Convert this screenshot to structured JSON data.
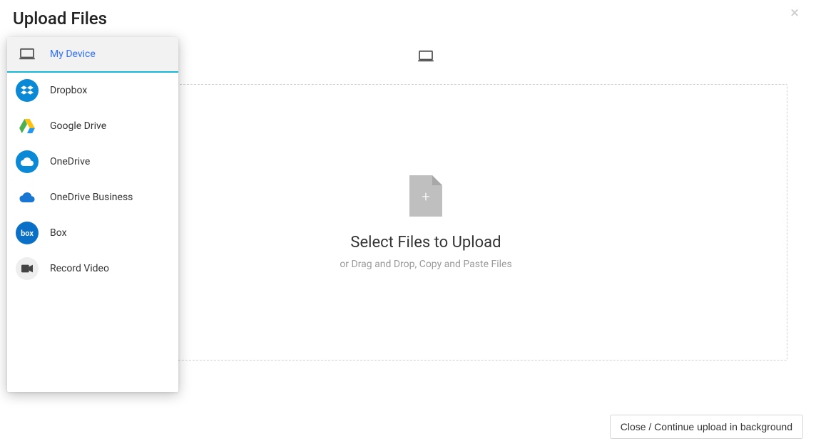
{
  "header": {
    "title": "Upload Files"
  },
  "sidebar": {
    "items": [
      {
        "label": "My Device"
      },
      {
        "label": "Dropbox"
      },
      {
        "label": "Google Drive"
      },
      {
        "label": "OneDrive"
      },
      {
        "label": "OneDrive Business"
      },
      {
        "label": "Box"
      },
      {
        "label": "Record Video"
      }
    ]
  },
  "dropzone": {
    "title": "Select Files to Upload",
    "subtitle": "or Drag and Drop, Copy and Paste Files"
  },
  "footer": {
    "button": "Close / Continue upload in background"
  }
}
